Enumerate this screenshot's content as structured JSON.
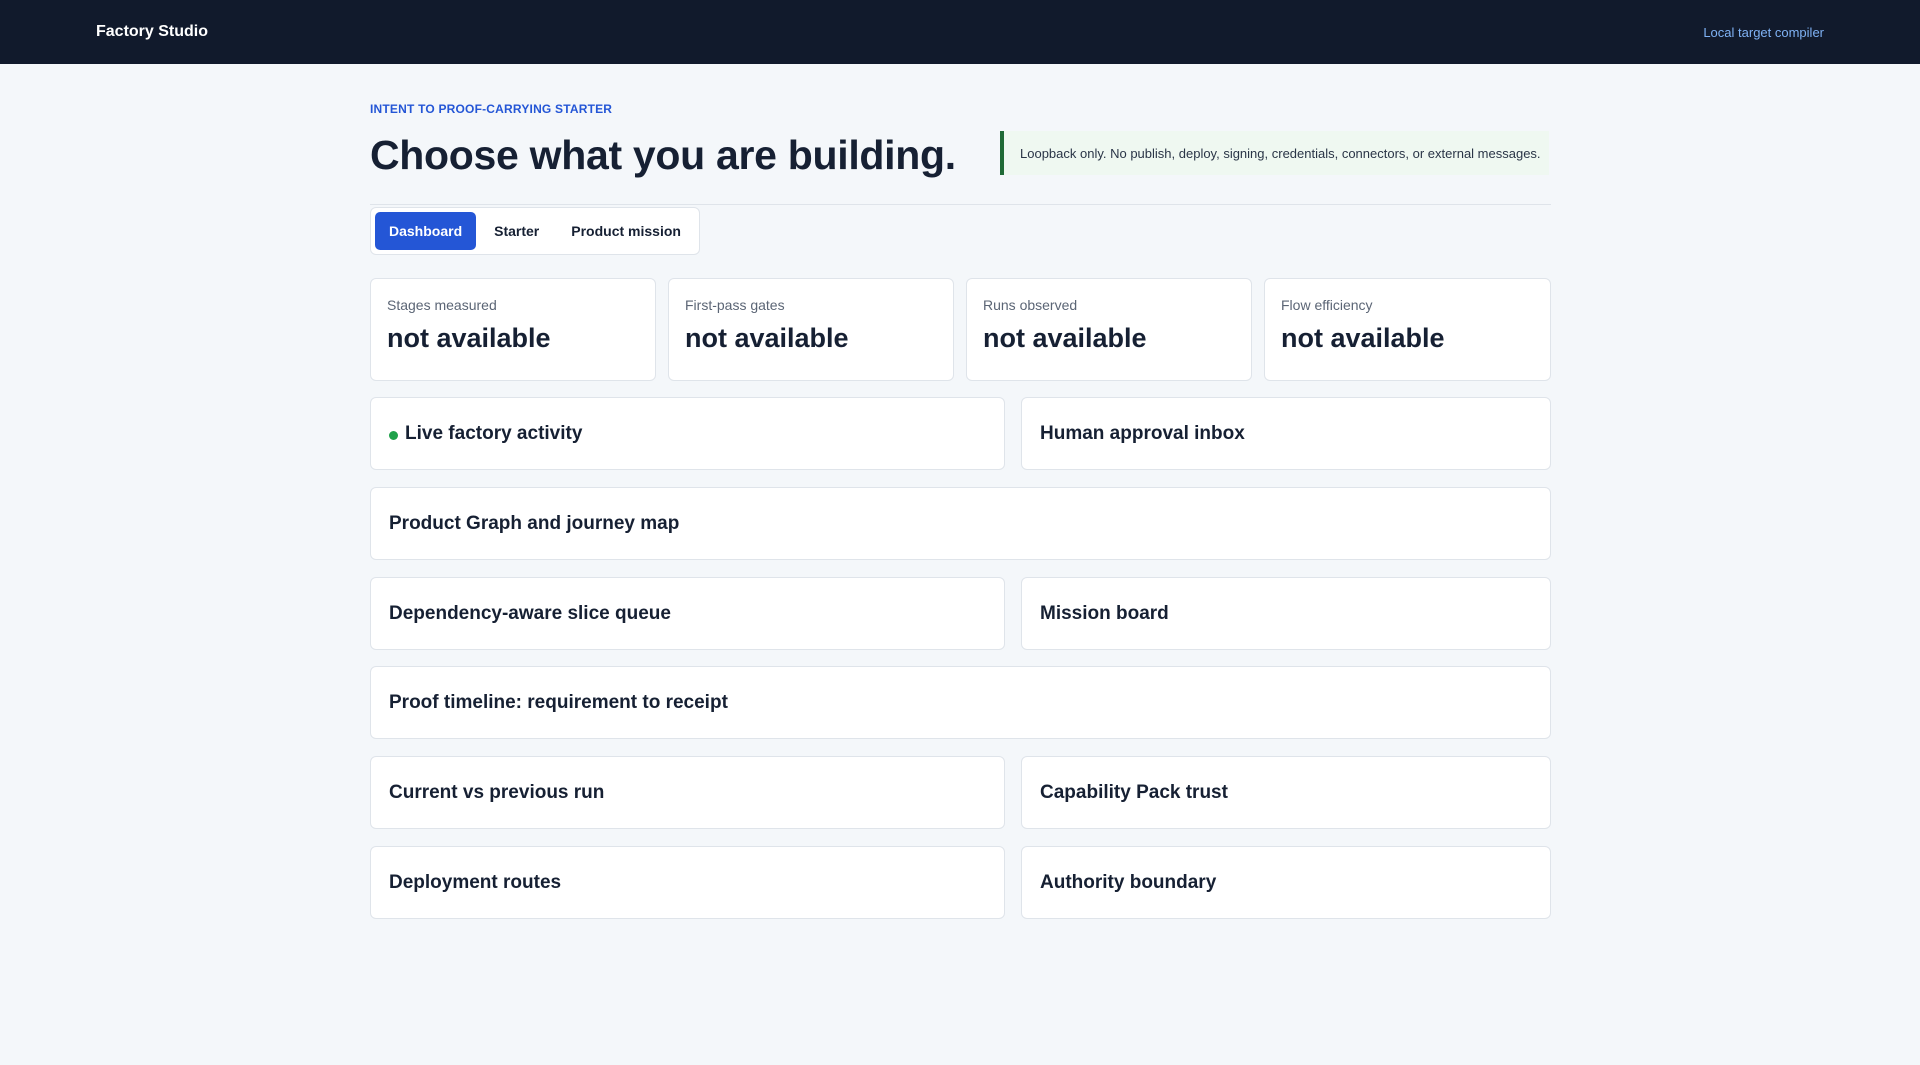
{
  "app": {
    "brand": "Factory Studio",
    "top_link": "Local target compiler"
  },
  "header": {
    "eyebrow": "INTENT TO PROOF-CARRYING STARTER",
    "title": "Choose what you are building.",
    "notice": "Loopback only. No publish, deploy, signing, credentials, connectors, or external messages."
  },
  "tabs": [
    {
      "label": "Dashboard",
      "active": true
    },
    {
      "label": "Starter",
      "active": false
    },
    {
      "label": "Product mission",
      "active": false
    }
  ],
  "metrics": [
    {
      "label": "Stages measured",
      "value": "not available"
    },
    {
      "label": "First-pass gates",
      "value": "not available"
    },
    {
      "label": "Runs observed",
      "value": "not available"
    },
    {
      "label": "Flow efficiency",
      "value": "not available"
    }
  ],
  "panels": {
    "live_activity": "Live factory activity",
    "approval_inbox": "Human approval inbox",
    "product_graph": "Product Graph and journey map",
    "slice_queue": "Dependency-aware slice queue",
    "mission_board": "Mission board",
    "proof_timeline": "Proof timeline: requirement to receipt",
    "run_compare": "Current vs previous run",
    "capability_trust": "Capability Pack trust",
    "deployment_routes": "Deployment routes",
    "authority_boundary": "Authority boundary"
  },
  "colors": {
    "topbar": "#111a2c",
    "accent": "#2456d6",
    "live_indicator": "#1fa14a",
    "notice_border": "#1f6a36"
  }
}
